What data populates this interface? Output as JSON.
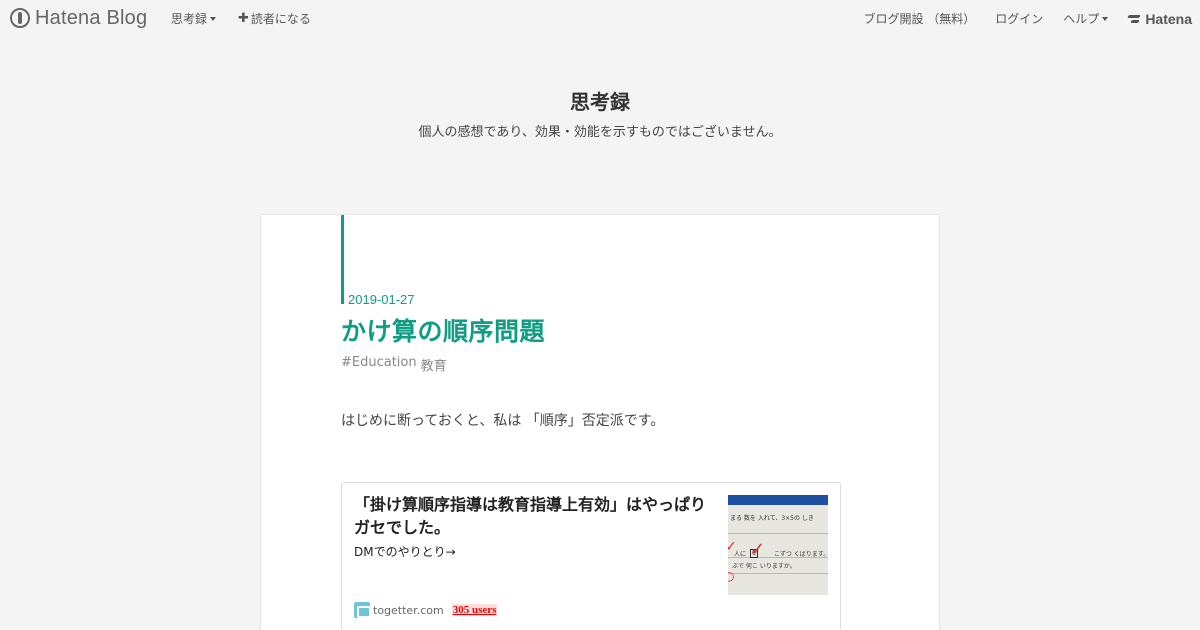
{
  "topbar": {
    "logo_text": "Hatena Blog",
    "nav_left": [
      {
        "label": "思考録"
      },
      {
        "label": "読者になる"
      }
    ],
    "nav_right": [
      {
        "label": "ブログ開設 （無料）"
      },
      {
        "label": "ログイン"
      },
      {
        "label": "ヘルプ"
      }
    ],
    "brand_text": "Hatena"
  },
  "blog": {
    "title": "思考録",
    "description": "個人の感想であり、効果・効能を示すものではございません。"
  },
  "entry": {
    "date": "2019-01-27",
    "title": "かけ算の順序問題",
    "categories": [
      "#Education",
      "教育"
    ],
    "body": "はじめに断っておくと、私は 「順序」否定派です。"
  },
  "embed": {
    "title": "「掛け算順序指導は教育指導上有効」はやっぱりガセでした。",
    "description": "DMでのやりとり→",
    "site": "togetter.com",
    "bookmark_users": "305 users",
    "thumbnail_text": [
      "まる 数を 入れて、3×5の しき",
      "人に",
      "6",
      "こずつ くばります。",
      "ぶで 何こ いりますか。"
    ]
  },
  "colors": {
    "accent": "#0f9d84",
    "background": "#f4f4f4",
    "bookmark_red": "#ee0000"
  }
}
